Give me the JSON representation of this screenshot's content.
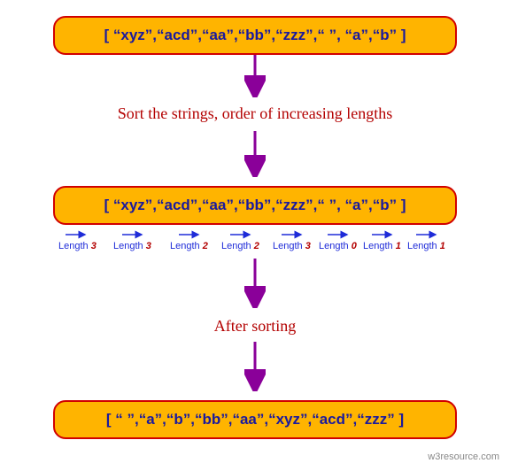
{
  "pills": {
    "input": "[ “xyz”,“acd”,“aa”,“bb”,“zzz”,“ ”, “a”,“b” ]",
    "middle": "[ “xyz”,“acd”,“aa”,“bb”,“zzz”,“ ”, “a”,“b” ]",
    "output": "[ “ ”,“a”,“b”,“bb”,“aa”,“xyz”,“acd”,“zzz” ]"
  },
  "captions": {
    "step1": "Sort the strings, order of increasing lengths",
    "step2": "After sorting"
  },
  "lengths": [
    {
      "label": "Length",
      "val": "3"
    },
    {
      "label": "Length",
      "val": "3"
    },
    {
      "label": "Length",
      "val": "2"
    },
    {
      "label": "Length",
      "val": "2"
    },
    {
      "label": "Length",
      "val": "3"
    },
    {
      "label": "Length",
      "val": "0"
    },
    {
      "label": "Length",
      "val": "1"
    },
    {
      "label": "Length",
      "val": "1"
    }
  ],
  "site": "w3resource.com"
}
